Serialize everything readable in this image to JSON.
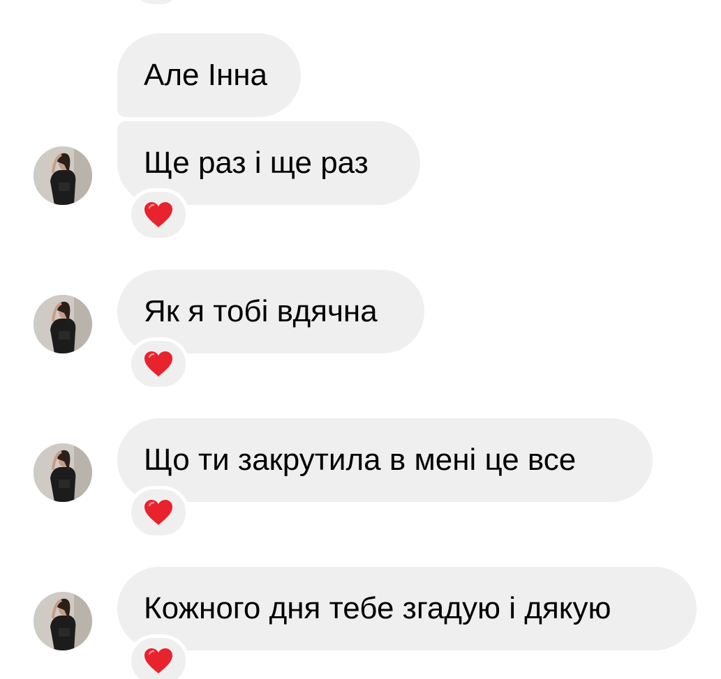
{
  "messages": [
    {
      "text": "Але Інна",
      "has_avatar": false,
      "reaction": null
    },
    {
      "text": "Ще раз і ще раз",
      "has_avatar": true,
      "reaction": "heart-icon"
    },
    {
      "text": "Як я тобі вдячна",
      "has_avatar": true,
      "reaction": "heart-icon"
    },
    {
      "text": "Що ти закрутила в мені це все",
      "has_avatar": true,
      "reaction": "heart-icon"
    },
    {
      "text": "Кожного дня тебе згадую і дякую",
      "has_avatar": true,
      "reaction": "heart-icon"
    }
  ],
  "colors": {
    "bubble": "#efefef",
    "text": "#000000",
    "heart": "#e8232e",
    "background": "#ffffff"
  }
}
